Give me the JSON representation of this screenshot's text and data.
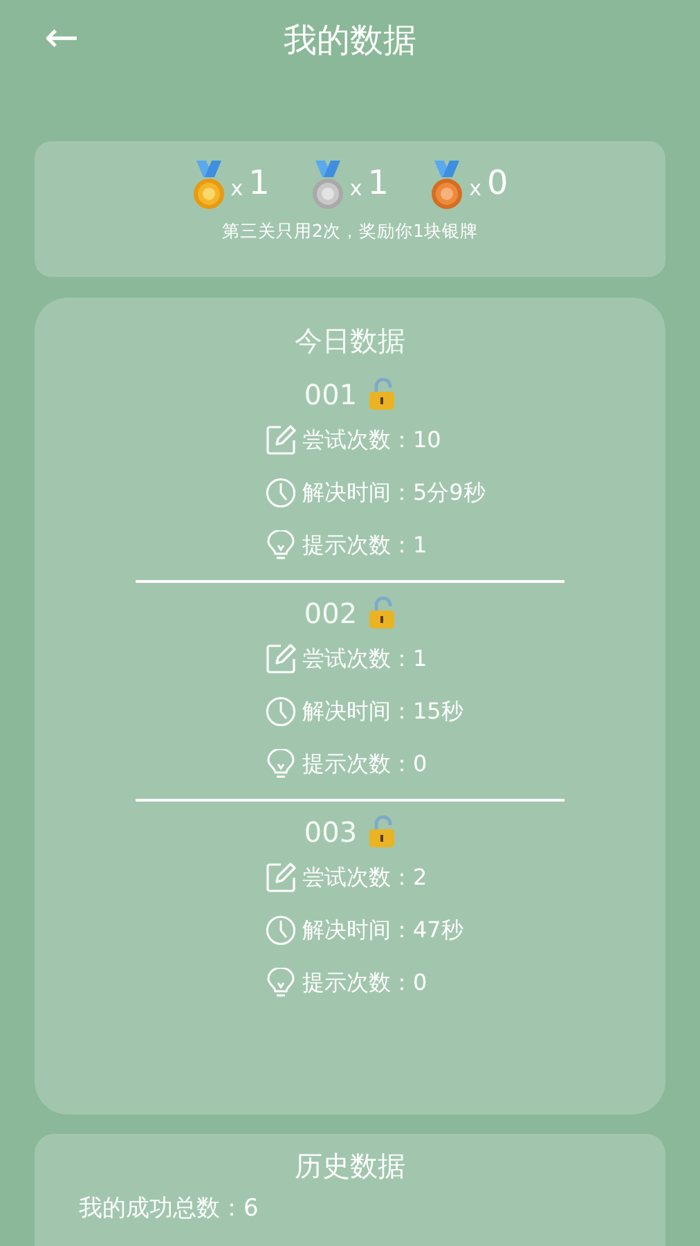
{
  "header": {
    "back_icon": "←",
    "title": "我的数据"
  },
  "medals": {
    "items": [
      {
        "kind": "gold",
        "count": "1",
        "prefix": "x"
      },
      {
        "kind": "silver",
        "count": "1",
        "prefix": "x"
      },
      {
        "kind": "bronze",
        "count": "0",
        "prefix": "x"
      }
    ],
    "caption": "第三关只用2次，奖励你1块银牌"
  },
  "today": {
    "title": "今日数据",
    "levels": [
      {
        "name": "001",
        "stats": [
          {
            "kind": "attempts",
            "text": "尝试次数：10"
          },
          {
            "kind": "time",
            "text": "解决时间：5分9秒"
          },
          {
            "kind": "hints",
            "text": "提示次数：1"
          }
        ]
      },
      {
        "name": "002",
        "stats": [
          {
            "kind": "attempts",
            "text": "尝试次数：1"
          },
          {
            "kind": "time",
            "text": "解决时间：15秒"
          },
          {
            "kind": "hints",
            "text": "提示次数：0"
          }
        ]
      },
      {
        "name": "003",
        "stats": [
          {
            "kind": "attempts",
            "text": "尝试次数：2"
          },
          {
            "kind": "time",
            "text": "解决时间：47秒"
          },
          {
            "kind": "hints",
            "text": "提示次数：0"
          }
        ]
      }
    ]
  },
  "history": {
    "title": "历史数据",
    "lines": [
      "我的成功总数：6"
    ]
  }
}
